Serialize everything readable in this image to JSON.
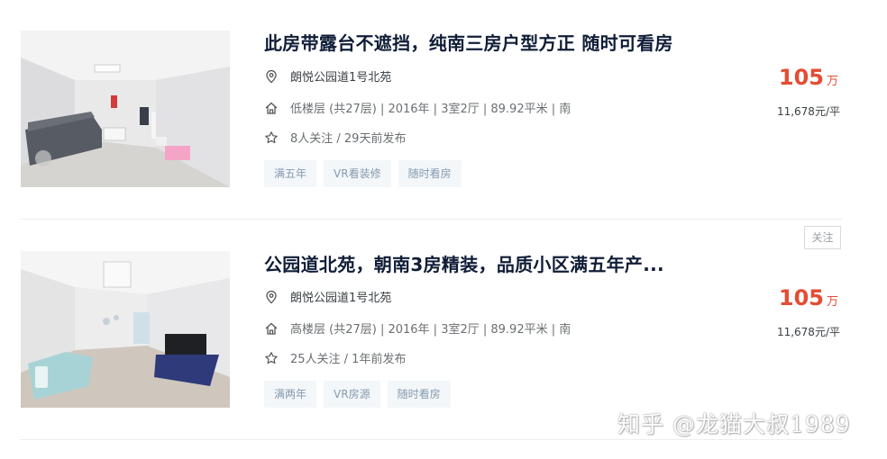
{
  "listings": [
    {
      "title": "此房带露台不遮挡，纯南三房户型方正 随时可看房",
      "address": "朗悦公园道1号北苑",
      "info": "低楼层 (共27层) | 2016年 | 3室2厅 | 89.92平米 | 南",
      "follow_info": "8人关注 / 29天前发布",
      "tags": [
        "满五年",
        "VR看装修",
        "随时看房"
      ],
      "price": "105",
      "price_unit": "万",
      "unit_price": "11,678元/平"
    },
    {
      "title": "公园道北苑，朝南3房精装，品质小区满五年产...",
      "address": "朗悦公园道1号北苑",
      "info": "高楼层 (共27层) | 2016年 | 3室2厅 | 89.92平米 | 南",
      "follow_info": "25人关注 / 1年前发布",
      "tags": [
        "满两年",
        "VR房源",
        "随时看房"
      ],
      "price": "105",
      "price_unit": "万",
      "unit_price": "11,678元/平",
      "follow_button": "关注"
    }
  ],
  "watermark": "知乎 @龙猫大叔1989",
  "icons": {
    "address": "location-pin-icon",
    "info": "house-icon",
    "follow": "star-icon",
    "vr_badge": "vr-badge-icon"
  },
  "colors": {
    "price": "#e34d33",
    "title": "#101d37",
    "tag_bg": "#f4f7f9",
    "tag_text": "#849aae"
  }
}
